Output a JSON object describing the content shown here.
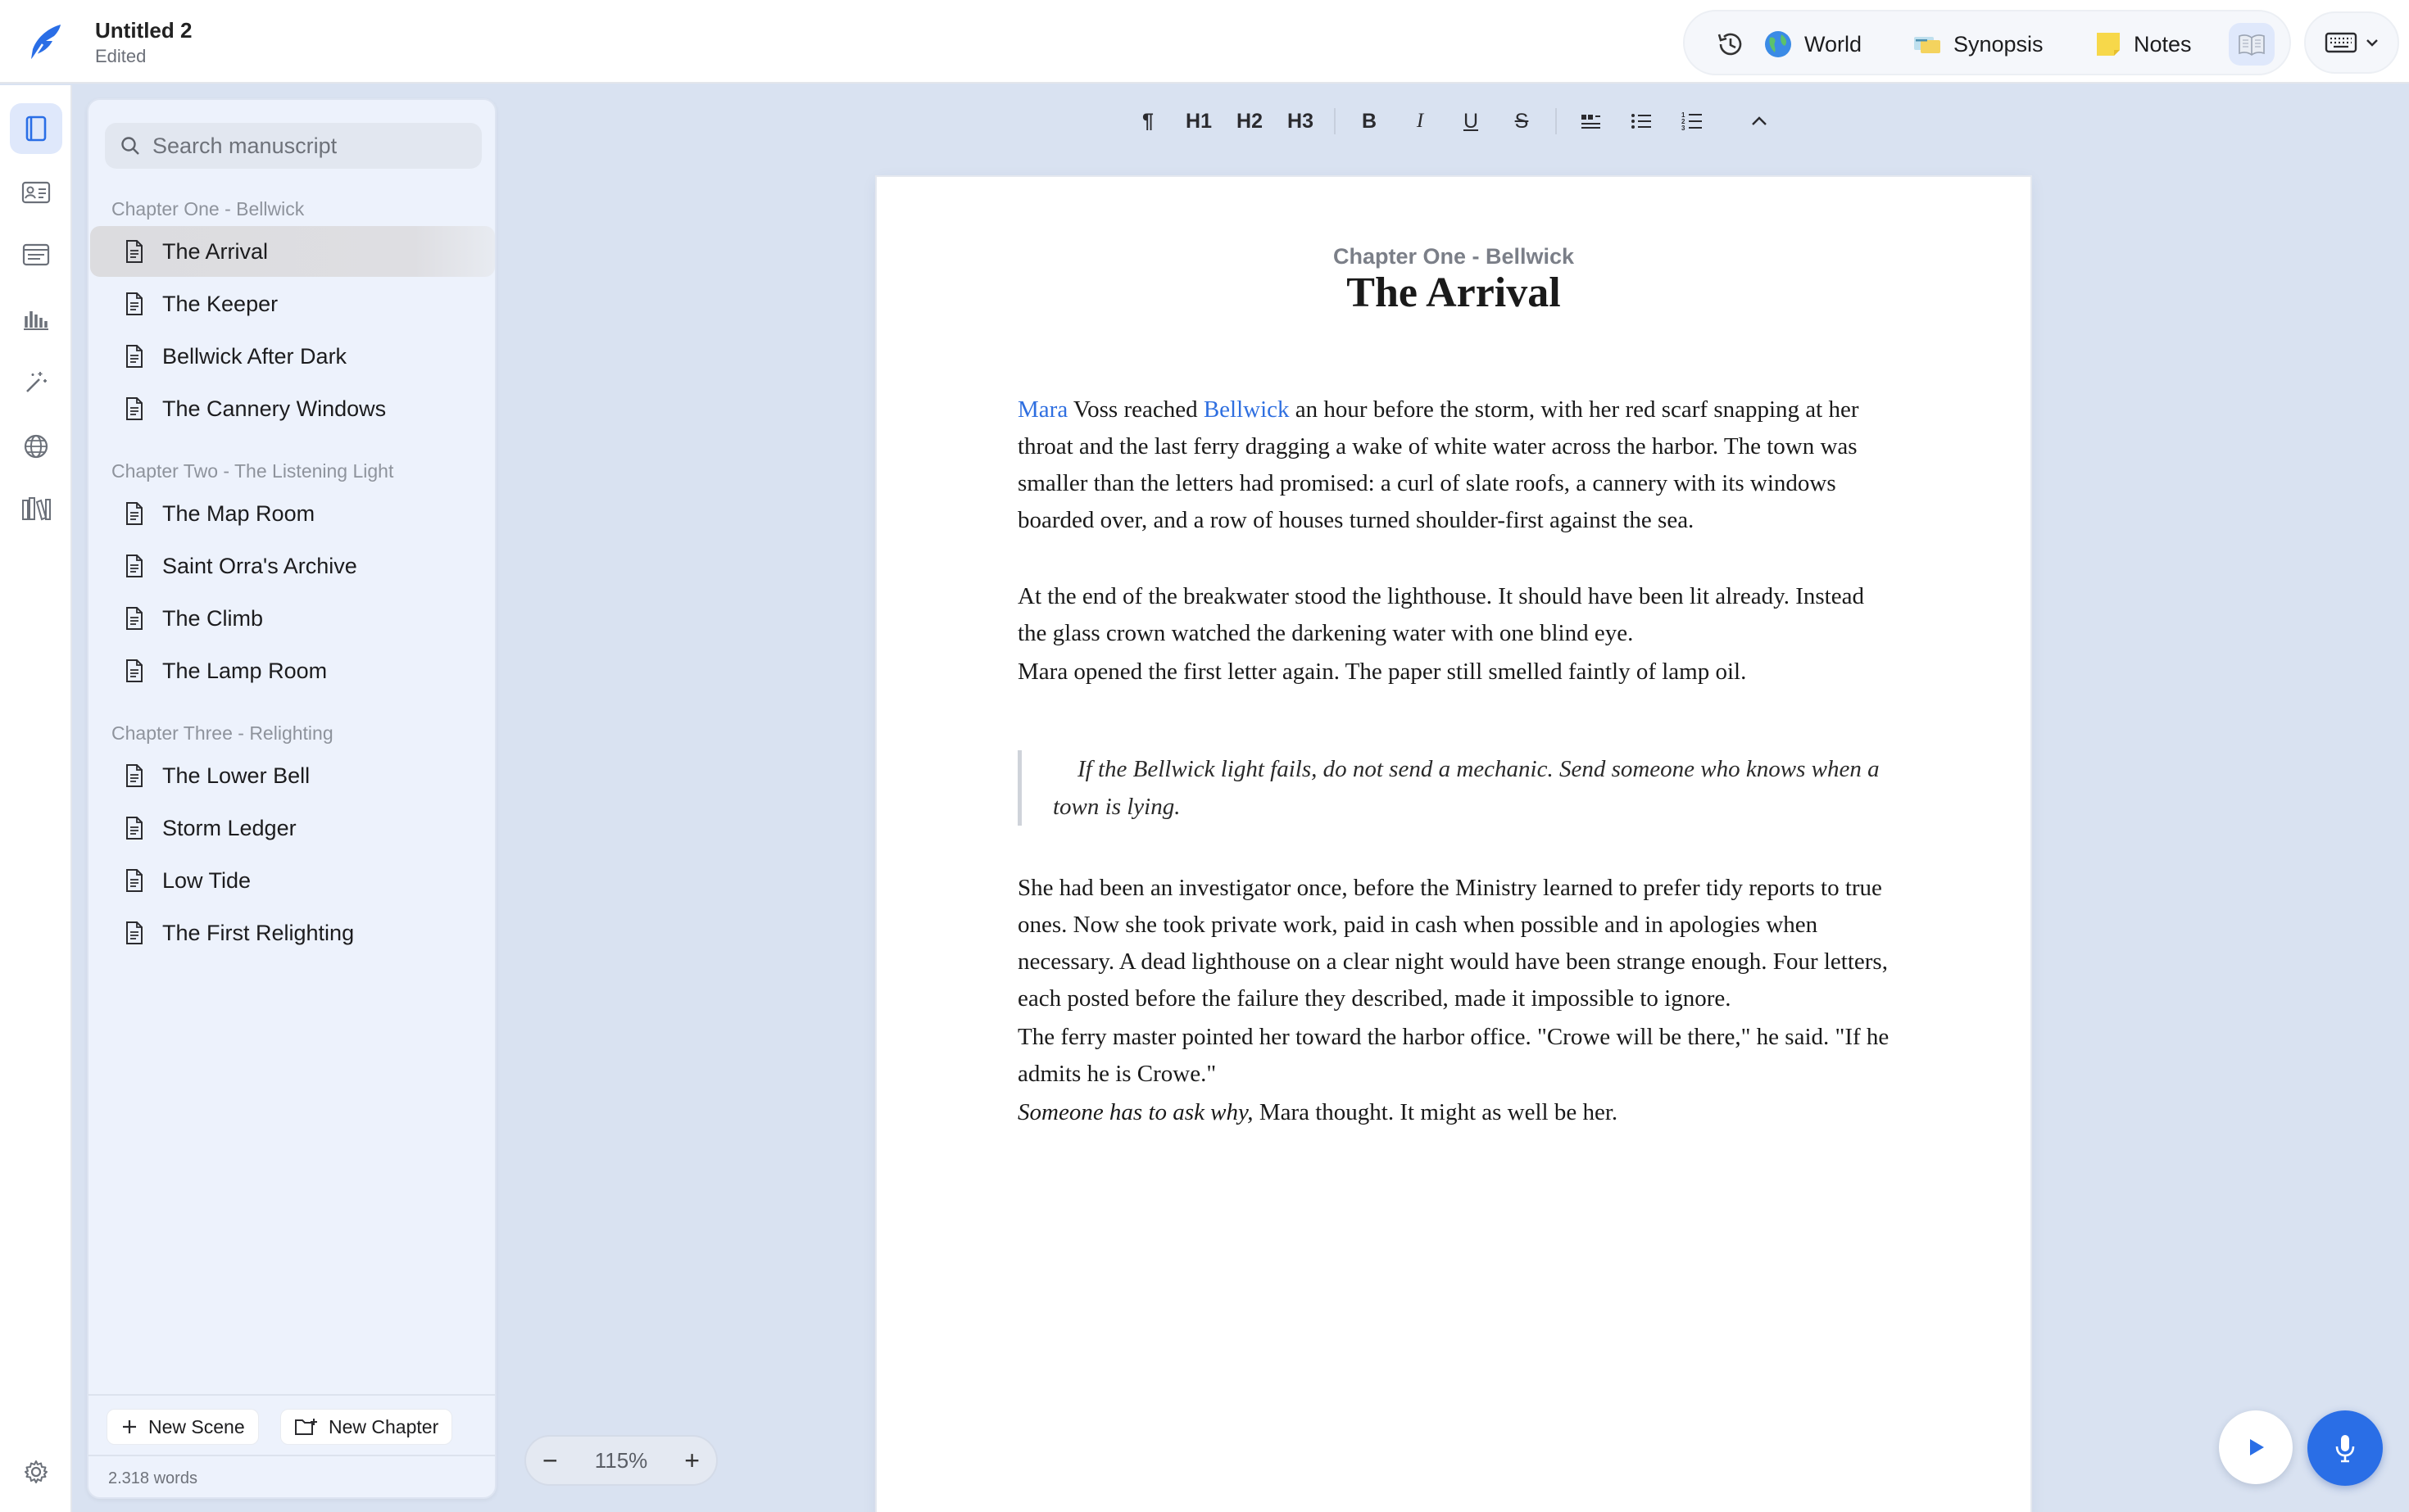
{
  "header": {
    "doc_title": "Untitled 2",
    "doc_status": "Edited",
    "buttons": {
      "world": "World",
      "synopsis": "Synopsis",
      "notes": "Notes"
    }
  },
  "search": {
    "placeholder": "Search manuscript"
  },
  "manuscript": {
    "chapters": [
      {
        "label": "Chapter One - Bellwick",
        "scenes": [
          "The Arrival",
          "The Keeper",
          "Bellwick After Dark",
          "The Cannery Windows"
        ]
      },
      {
        "label": "Chapter Two - The Listening Light",
        "scenes": [
          "The Map Room",
          "Saint Orra's Archive",
          "The Climb",
          "The Lamp Room"
        ]
      },
      {
        "label": "Chapter Three - Relighting",
        "scenes": [
          "The Lower Bell",
          "Storm Ledger",
          "Low Tide",
          "The First Relighting"
        ]
      }
    ],
    "selected_scene": "The Arrival"
  },
  "footer": {
    "new_scene": "New Scene",
    "new_chapter": "New Chapter",
    "word_count": "2.318 words"
  },
  "toolbar": {
    "paragraph": "¶",
    "h1": "H1",
    "h2": "H2",
    "h3": "H3",
    "bold": "B",
    "italic": "I",
    "underline": "U",
    "strike": "S"
  },
  "page": {
    "chapter": "Chapter One - Bellwick",
    "title": "The Arrival",
    "p1_link1": "Mara",
    "p1_a": " Voss reached ",
    "p1_link2": "Bellwick",
    "p1_b": " an hour before the storm, with her red scarf snapping at her throat and the last ferry dragging a wake of white water across the harbor. The town was smaller than the letters had promised: a curl of slate roofs, a cannery with its windows boarded over, and a row of houses turned shoulder-first against the sea.",
    "p2": "At the end of the breakwater stood the lighthouse. It should have been lit already. Instead the glass crown watched the darkening water with one blind eye.",
    "p3": "Mara opened the first letter again. The paper still smelled faintly of lamp oil.",
    "quote": "If the Bellwick light fails, do not send a mechanic. Send someone who knows when a town is lying.",
    "p4": "She had been an investigator once, before the Ministry learned to prefer tidy reports to true ones. Now she took private work, paid in cash when possible and in apologies when necessary. A dead lighthouse on a clear night would have been strange enough. Four letters, each posted before the failure they described, made it impossible to ignore.",
    "p5": "The ferry master pointed her toward the harbor office. \"Crowe will be there,\" he said. \"If he admits he is Crowe.\"",
    "p6_italic": "Someone has to ask why,",
    "p6_rest": " Mara thought. It might as well be her."
  },
  "zoom": {
    "minus": "−",
    "value": "115%",
    "plus": "+"
  },
  "colors": {
    "accent": "#2a6ee6",
    "link": "#2f6fe0",
    "background": "#d9e2f1"
  }
}
